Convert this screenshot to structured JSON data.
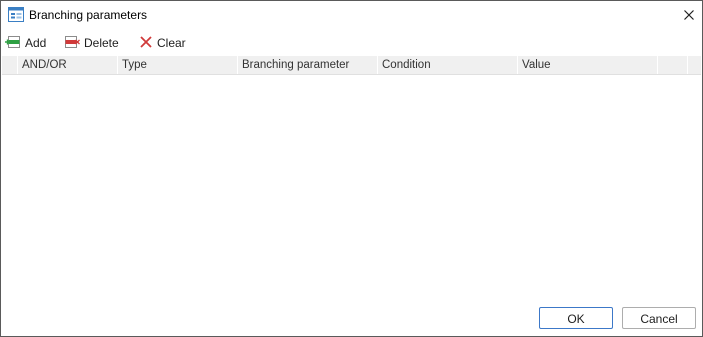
{
  "window": {
    "title": "Branching parameters",
    "icon": "window-icon",
    "close_icon": "close-icon"
  },
  "toolbar": {
    "add_label": "Add",
    "delete_label": "Delete",
    "clear_label": "Clear",
    "add_icon": "add-row-icon",
    "delete_icon": "delete-row-icon",
    "clear_icon": "clear-x-icon"
  },
  "grid": {
    "columns": [
      "AND/OR",
      "Type",
      "Branching parameter",
      "Condition",
      "Value"
    ],
    "rows": []
  },
  "footer": {
    "ok_label": "OK",
    "cancel_label": "Cancel"
  },
  "colors": {
    "add_accent": "#2ea043",
    "delete_accent": "#d03a3a",
    "clear_accent": "#d03a3a",
    "ok_border": "#3c78c8",
    "header_bg": "#f0f0f0"
  }
}
